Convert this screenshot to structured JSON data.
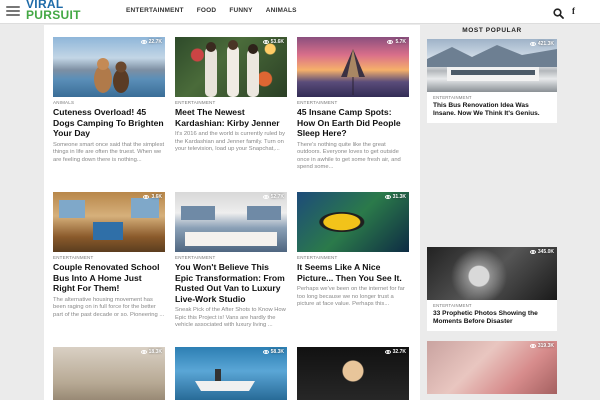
{
  "header": {
    "logo_line1": "VIRAL",
    "logo_line2": "PURSUIT",
    "nav": [
      "ENTERTAINMENT",
      "FOOD",
      "FUNNY",
      "ANIMALS"
    ],
    "icons": [
      "menu-icon",
      "search-icon",
      "facebook-icon"
    ]
  },
  "articles": [
    {
      "views": "22.7K",
      "category": "ANIMALS",
      "title": "Cuteness Overload! 45 Dogs Camping To Brighten Your Day",
      "excerpt": "Someone smart once said that the simplest things in life are often the truest. When we are feeling down there is nothing..."
    },
    {
      "views": "53.6K",
      "category": "ENTERTAINMENT",
      "title": "Meet The Newest Kardashian: Kirby Jenner",
      "excerpt": "It's 2016 and the world is currently ruled by the Kardashian and Jenner family. Turn on your television, load up your Snapchat,..."
    },
    {
      "views": "5.7K",
      "category": "ENTERTAINMENT",
      "title": "45 Insane Camp Spots: How On Earth Did People Sleep Here?",
      "excerpt": "There's nothing quite like the great outdoors. Everyone loves to get outside once in awhile to get some fresh air, and spend some..."
    },
    {
      "views": "3.6K",
      "category": "ENTERTAINMENT",
      "title": "Couple Renovated School Bus Into A Home Just Right For Them!",
      "excerpt": "The alternative housing movement has been raging on in full force for the better part of the past decade or so. Pioneering ..."
    },
    {
      "views": "52.7K",
      "category": "ENTERTAINMENT",
      "title": "You Won't Believe This Epic Transformation: From Rusted Out Van to Luxury Live-Work Studio",
      "excerpt": "Sneak Pick of the After Shots to Know How Epic this Project is! Vans are hardly the vehicle associated with luxury living ..."
    },
    {
      "views": "31.3K",
      "category": "ENTERTAINMENT",
      "title": "It Seems Like A Nice Picture... Then You See It.",
      "excerpt": "Perhaps we've been on the internet for far too long because we no longer trust a picture at face value. Perhaps this..."
    },
    {
      "views": "18.3K",
      "category": "",
      "title": "",
      "excerpt": ""
    },
    {
      "views": "58.3K",
      "category": "",
      "title": "",
      "excerpt": ""
    },
    {
      "views": "32.7K",
      "category": "",
      "title": "",
      "excerpt": ""
    }
  ],
  "sidebar": {
    "heading": "MOST POPULAR",
    "items": [
      {
        "views": "421.3K",
        "category": "ENTERTAINMENT",
        "title": "This Bus Renovation Idea Was Insane. Now We Think It's Genius."
      },
      {
        "views": "345.0K",
        "category": "ENTERTAINMENT",
        "title": "33 Prophetic Photos Showing the Moments Before Disaster"
      },
      {
        "views": "319.3K",
        "category": "",
        "title": ""
      }
    ]
  }
}
